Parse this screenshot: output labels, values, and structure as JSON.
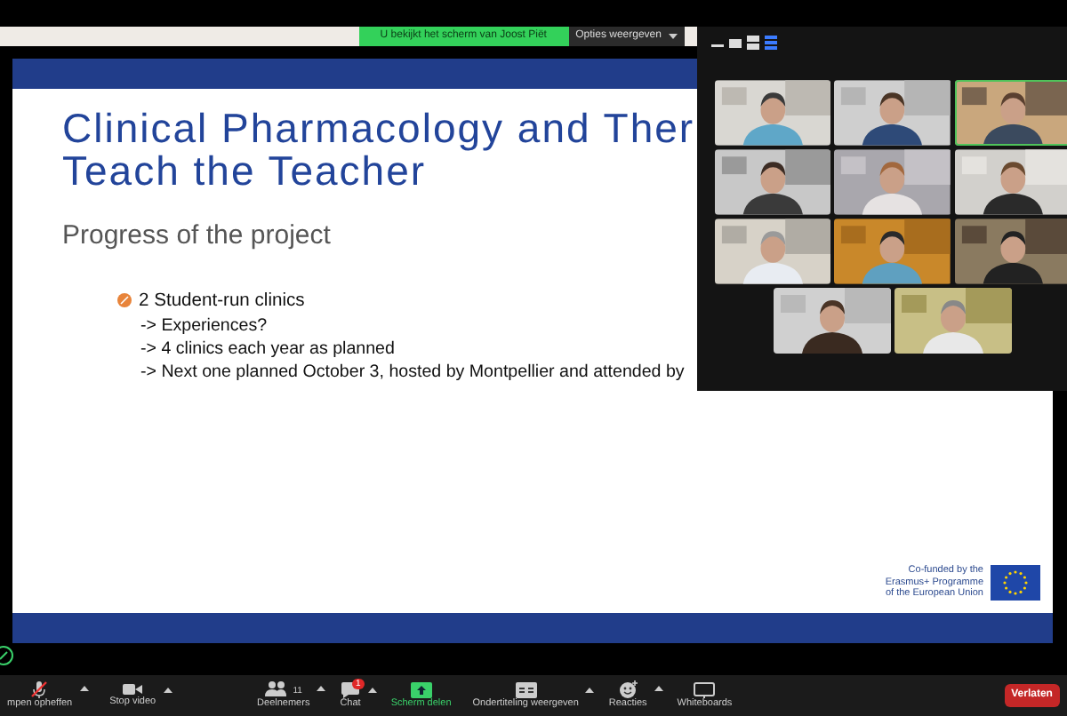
{
  "share_banner": {
    "text": "U bekijkt het scherm van Joost Piët",
    "options_button": "Opties weergeven"
  },
  "slide": {
    "title_lines": [
      "Clinical Pharmacology and Ther",
      "Teach the Teacher"
    ],
    "subtitle": "Progress of the project",
    "bullet": {
      "text": "2 Student-run clinics",
      "lines": [
        "-> Experiences?",
        "-> 4 clinics each year as planned",
        "-> Next one planned October 3, hosted by Montpellier and attended by"
      ]
    },
    "funding_note": [
      "Co-funded by the",
      "Erasmus+ Programme",
      "of the European Union"
    ]
  },
  "gallery": {
    "view_modes": [
      {
        "kind": "minimize",
        "selected": false
      },
      {
        "kind": "speaker",
        "selected": false
      },
      {
        "kind": "strip",
        "selected": false
      },
      {
        "kind": "grid",
        "selected": true
      }
    ],
    "rows": [
      [
        {
          "kind": "picture",
          "speaking": false
        },
        {
          "kind": "picture",
          "speaking": false
        },
        {
          "kind": "picture",
          "speaking": true
        }
      ],
      [
        {
          "kind": "picture",
          "speaking": false
        },
        {
          "kind": "picture",
          "speaking": false
        },
        {
          "kind": "picture",
          "speaking": false
        }
      ],
      [
        {
          "kind": "picture",
          "speaking": false
        },
        {
          "kind": "picture",
          "speaking": false
        },
        {
          "kind": "picture",
          "speaking": false
        }
      ],
      [
        {
          "kind": "picture",
          "speaking": false
        },
        {
          "kind": "picture",
          "speaking": false
        }
      ]
    ]
  },
  "toolbar": {
    "left": [
      {
        "kind": "mic",
        "label": "mpen opheffen",
        "has_menu": true
      },
      {
        "kind": "video",
        "label": "Stop video",
        "has_menu": true
      }
    ],
    "center": [
      {
        "kind": "participants",
        "label": "Deelnemers",
        "count": "11",
        "has_menu": true
      },
      {
        "kind": "chat",
        "label": "Chat",
        "badge": "1",
        "has_menu": true
      },
      {
        "kind": "share",
        "label": "Scherm delen",
        "has_menu": false
      },
      {
        "kind": "captions",
        "label": "Ondertiteling weergeven",
        "has_menu": true
      },
      {
        "kind": "reactions",
        "label": "Reacties",
        "has_menu": true
      },
      {
        "kind": "whiteboard",
        "label": "Whiteboards",
        "has_menu": false
      }
    ],
    "leave_button": "Verlaten"
  }
}
